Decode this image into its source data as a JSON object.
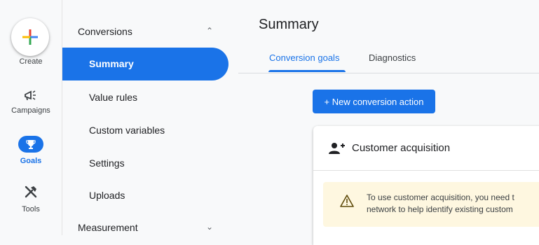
{
  "rail": {
    "create_label": "Create",
    "campaigns_label": "Campaigns",
    "goals_label": "Goals",
    "tools_label": "Tools"
  },
  "nav": {
    "conversions_label": "Conversions",
    "items": [
      "Summary",
      "Value rules",
      "Custom variables",
      "Settings",
      "Uploads"
    ],
    "measurement_label": "Measurement"
  },
  "main": {
    "title": "Summary",
    "tabs": [
      "Conversion goals",
      "Diagnostics"
    ],
    "new_button": "+ New conversion action",
    "card_title": "Customer acquisition",
    "warning_line1": "To use customer acquisition, you need t",
    "warning_line2": "network to help identify existing custom"
  },
  "colors": {
    "accent": "#1a73e8",
    "warning_bg": "#fef7e0"
  }
}
